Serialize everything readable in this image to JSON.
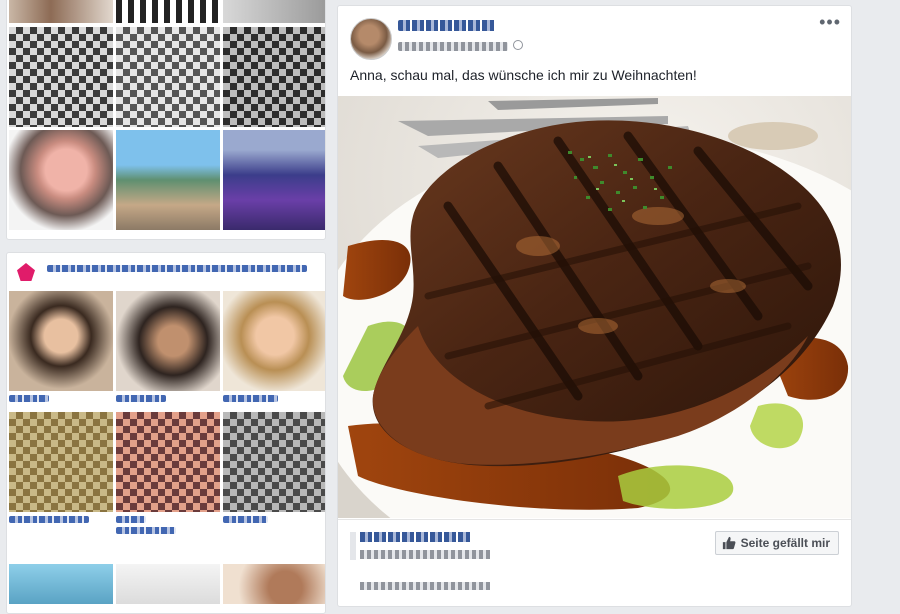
{
  "post": {
    "text": "Anna, schau mal, das wünsche ich mir zu Weihnachten!",
    "like_page_label": "Seite gefällt mir",
    "more_label": "•••"
  },
  "icons": {
    "more": "more-options-icon",
    "privacy": "globe-icon",
    "like": "thumbs-up-icon",
    "page": "page-logo-icon"
  },
  "colors": {
    "facebook_blue": "#4267b2",
    "page_background": "#e9ebee",
    "card_border": "#dddfe2"
  }
}
